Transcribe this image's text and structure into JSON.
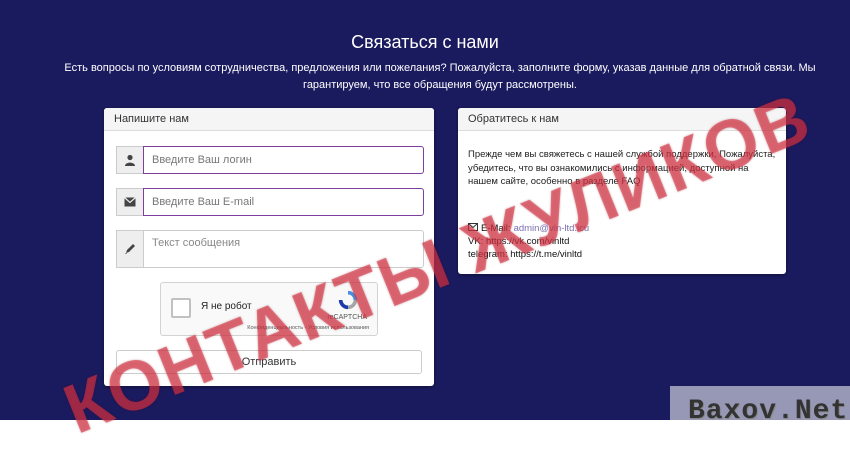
{
  "page": {
    "title": "Связаться с нами",
    "subtitle": "Есть вопросы по условиям сотрудничества, предложения или пожелания? Пожалуйста, заполните форму, указав данные для обратной связи. Мы гарантируем, что все обращения будут рассмотрены."
  },
  "form": {
    "header": "Напишите нам",
    "login_placeholder": "Введите Ваш логин",
    "email_placeholder": "Введите Ваш E-mail",
    "message_placeholder": "Текст сообщения",
    "login_icon": "user-icon",
    "email_icon": "envelope-icon",
    "message_icon": "pencil-icon",
    "submit_label": "Отправить"
  },
  "recaptcha": {
    "label": "Я не робот",
    "brand": "reCAPTCHA",
    "terms": "Конфиденциальность - Условия использования"
  },
  "info": {
    "header": "Обратитесь к нам",
    "text": "Прежде чем вы свяжетесь с нашей службой поддержки, Пожалуйста, убедитесь, что вы ознакомились с информацией, доступной на нашем сайте, особенно в разделе FAQ",
    "email_label": "E-Mail: ",
    "email_value": "admin@vin-ltd.icu",
    "vk_label": "VK: https://vk.com/vinltd",
    "telegram_label": "telegram: https://t.me/vinltd"
  },
  "overlay": {
    "watermark": "КОНТАКТЫ ЖУЛИКОВ",
    "site": "Baxov.Net"
  },
  "colors": {
    "background": "#1a1a5e",
    "field_focus_border": "#7b3fa0",
    "watermark": "#dc3746"
  }
}
